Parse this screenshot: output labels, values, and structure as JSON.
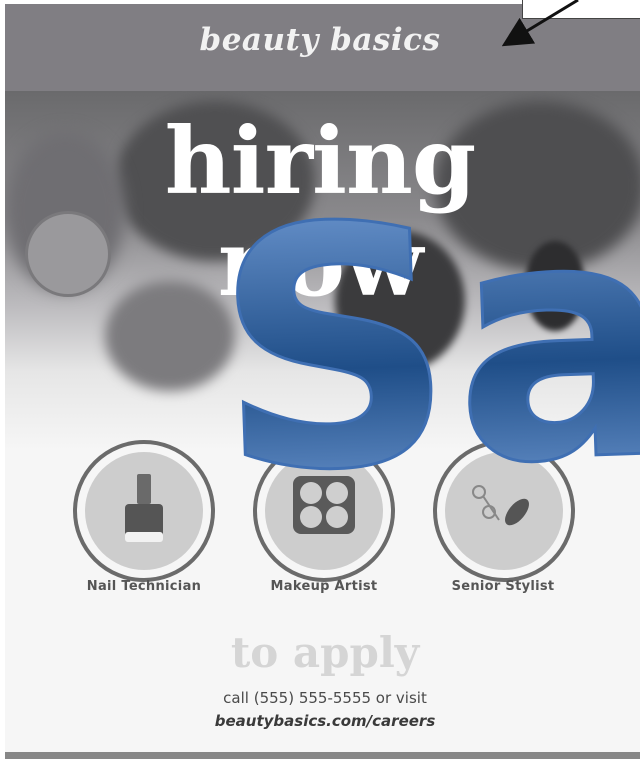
{
  "brand": {
    "name": "beauty basics"
  },
  "hero": {
    "line1": "hiring",
    "line2": "now"
  },
  "overlay": {
    "wordart": "Sar"
  },
  "roles": [
    {
      "label": "Nail Technician",
      "icon": "nail-polish-icon"
    },
    {
      "label": "Makeup Artist",
      "icon": "eyeshadow-palette-icon"
    },
    {
      "label": "Senior Stylist",
      "icon": "scissors-brush-icon"
    }
  ],
  "apply": {
    "heading": "to apply",
    "line1": "call (555) 555-5555 or visit",
    "line2": "beautybasics.com/careers"
  },
  "colors": {
    "banner": "#807e83",
    "wordart_fill_top": "#7aa3dc",
    "wordart_fill_bottom": "#1f4e88",
    "ring": "#6b6b6b"
  }
}
